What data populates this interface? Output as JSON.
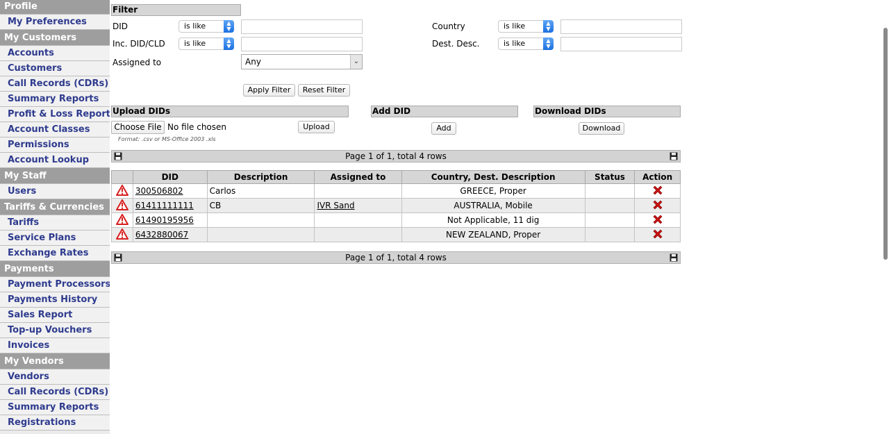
{
  "sidebar": {
    "sections": [
      {
        "title": "Profile",
        "items": [
          "My Preferences"
        ]
      },
      {
        "title": "My Customers",
        "items": [
          "Accounts",
          "Customers",
          "Call Records (CDRs)",
          "Summary Reports",
          "Profit & Loss Report",
          "Account Classes",
          "Permissions",
          "Account Lookup"
        ]
      },
      {
        "title": "My Staff",
        "items": [
          "Users"
        ]
      },
      {
        "title": "Tariffs & Currencies",
        "items": [
          "Tariffs",
          "Service Plans",
          "Exchange Rates"
        ]
      },
      {
        "title": "Payments",
        "items": [
          "Payment Processors",
          "Payments History",
          "Sales Report",
          "Top-up Vouchers",
          "Invoices"
        ]
      },
      {
        "title": "My Vendors",
        "items": [
          "Vendors",
          "Call Records (CDRs)",
          "Summary Reports",
          "Registrations"
        ]
      }
    ]
  },
  "filter": {
    "title": "Filter",
    "did_label": "DID",
    "did_op": "is like",
    "inc_label": "Inc. DID/CLD",
    "inc_op": "is like",
    "assigned_label": "Assigned to",
    "assigned_value": "Any",
    "country_label": "Country",
    "country_op": "is like",
    "dest_label": "Dest. Desc.",
    "dest_op": "is like",
    "apply_label": "Apply Filter",
    "reset_label": "Reset Filter"
  },
  "upload": {
    "title": "Upload DIDs",
    "choose_label": "Choose File",
    "no_file": "No file chosen",
    "upload_label": "Upload",
    "format_hint": "Format: .csv or MS-Office 2003 .xls"
  },
  "add": {
    "title": "Add DID",
    "button": "Add"
  },
  "download": {
    "title": "Download DIDs",
    "button": "Download"
  },
  "pager": {
    "text": "Page 1 of 1, total 4 rows"
  },
  "table": {
    "columns": [
      "DID",
      "Description",
      "Assigned to",
      "Country, Dest. Description",
      "Status",
      "Action"
    ],
    "rows": [
      {
        "did": "300506802",
        "description": "Carlos",
        "assigned": "",
        "country": "GREECE, Proper",
        "status": ""
      },
      {
        "did": "61411111111",
        "description": "CB",
        "assigned": "IVR Sand",
        "country": "AUSTRALIA, Mobile",
        "status": ""
      },
      {
        "did": "61490195956",
        "description": "",
        "assigned": "",
        "country": "Not Applicable, 11 dig",
        "status": ""
      },
      {
        "did": "6432880067",
        "description": "",
        "assigned": "",
        "country": "NEW ZEALAND, Proper",
        "status": ""
      }
    ]
  },
  "colors": {
    "sidebar_link": "#2e3b8e",
    "sidebar_header": "#9e9e9e",
    "delete_icon": "#cc1111",
    "warning_icon": "#d81e1e"
  }
}
